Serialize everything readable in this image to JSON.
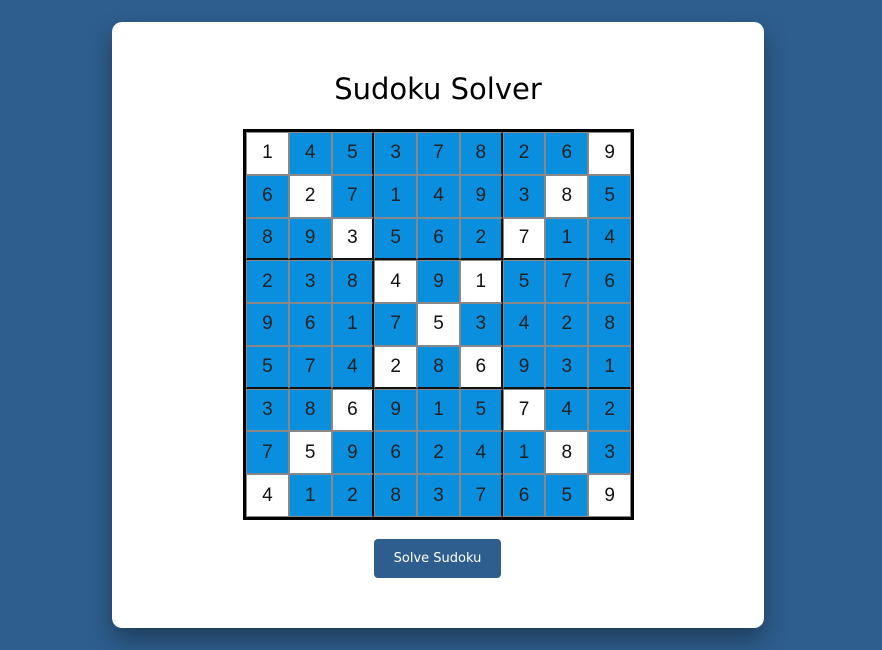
{
  "page": {
    "title": "Sudoku Solver",
    "colors": {
      "background": "#2e5e8e",
      "card": "#ffffff",
      "filled_cell": "#0a8ede",
      "given_cell": "#ffffff",
      "button": "#2e5e8e"
    }
  },
  "sudoku": {
    "rows": [
      [
        "1",
        "4",
        "5",
        "3",
        "7",
        "8",
        "2",
        "6",
        "9"
      ],
      [
        "6",
        "2",
        "7",
        "1",
        "4",
        "9",
        "3",
        "8",
        "5"
      ],
      [
        "8",
        "9",
        "3",
        "5",
        "6",
        "2",
        "7",
        "1",
        "4"
      ],
      [
        "2",
        "3",
        "8",
        "4",
        "9",
        "1",
        "5",
        "7",
        "6"
      ],
      [
        "9",
        "6",
        "1",
        "7",
        "5",
        "3",
        "4",
        "2",
        "8"
      ],
      [
        "5",
        "7",
        "4",
        "2",
        "8",
        "6",
        "9",
        "3",
        "1"
      ],
      [
        "3",
        "8",
        "6",
        "9",
        "1",
        "5",
        "7",
        "4",
        "2"
      ],
      [
        "7",
        "5",
        "9",
        "6",
        "2",
        "4",
        "1",
        "8",
        "3"
      ],
      [
        "4",
        "1",
        "2",
        "8",
        "3",
        "7",
        "6",
        "5",
        "9"
      ]
    ],
    "given": [
      [
        1,
        0,
        0,
        0,
        0,
        0,
        0,
        0,
        1
      ],
      [
        0,
        1,
        0,
        0,
        0,
        0,
        0,
        1,
        0
      ],
      [
        0,
        0,
        1,
        0,
        0,
        0,
        1,
        0,
        0
      ],
      [
        0,
        0,
        0,
        1,
        0,
        1,
        0,
        0,
        0
      ],
      [
        0,
        0,
        0,
        0,
        1,
        0,
        0,
        0,
        0
      ],
      [
        0,
        0,
        0,
        1,
        0,
        1,
        0,
        0,
        0
      ],
      [
        0,
        0,
        1,
        0,
        0,
        0,
        1,
        0,
        0
      ],
      [
        0,
        1,
        0,
        0,
        0,
        0,
        0,
        1,
        0
      ],
      [
        1,
        0,
        0,
        0,
        0,
        0,
        0,
        0,
        1
      ]
    ]
  },
  "actions": {
    "solve_label": "Solve Sudoku"
  }
}
